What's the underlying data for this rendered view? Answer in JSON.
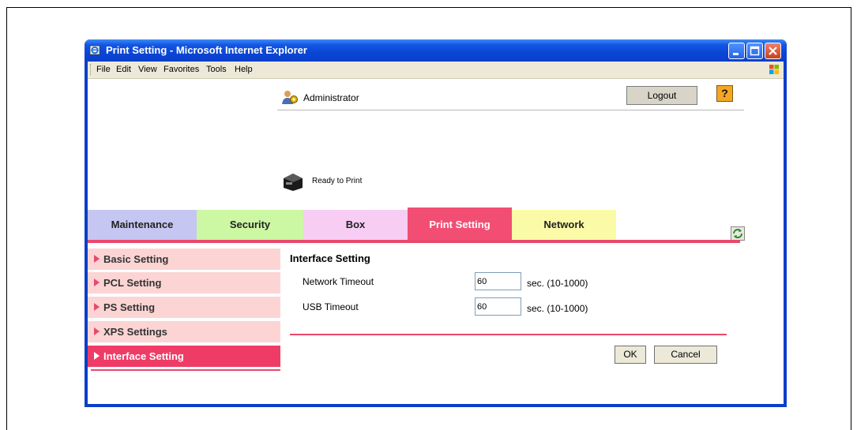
{
  "window": {
    "title": "Print Setting - Microsoft Internet Explorer",
    "colors": {
      "titlebar": "#0a3fc8",
      "accent": "#e8496d"
    }
  },
  "menu": [
    "File",
    "Edit",
    "View",
    "Favorites",
    "Tools",
    "Help"
  ],
  "header": {
    "user": "Administrator",
    "logout_label": "Logout",
    "help_label": "?",
    "status": "Ready to Print"
  },
  "tabs": [
    {
      "label": "Maintenance",
      "color": "#c6c6f2"
    },
    {
      "label": "Security",
      "color": "#ccf7a3"
    },
    {
      "label": "Box",
      "color": "#f7cdf4"
    },
    {
      "label": "Print Setting",
      "color": "#f24e74",
      "active": true
    },
    {
      "label": "Network",
      "color": "#fbfba7"
    }
  ],
  "sidebar": {
    "items": [
      {
        "label": "Basic Setting"
      },
      {
        "label": "PCL Setting"
      },
      {
        "label": "PS Setting"
      },
      {
        "label": "XPS Settings"
      },
      {
        "label": "Interface Setting",
        "active": true
      }
    ]
  },
  "main": {
    "title": "Interface Setting",
    "fields": [
      {
        "label": "Network Timeout",
        "value": "60",
        "unit": "sec. (10-1000)"
      },
      {
        "label": "USB Timeout",
        "value": "60",
        "unit": "sec. (10-1000)"
      }
    ],
    "ok_label": "OK",
    "cancel_label": "Cancel"
  }
}
